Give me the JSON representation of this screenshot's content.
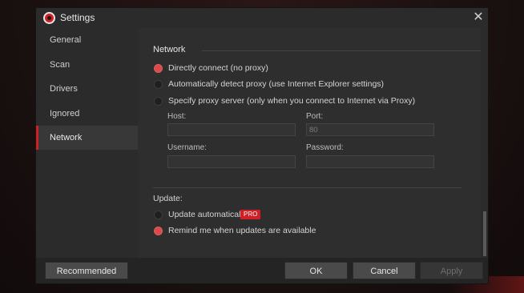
{
  "window": {
    "title": "Settings",
    "close_icon": "close-icon",
    "logo_icon": "app-logo-icon"
  },
  "sidebar": {
    "items": [
      {
        "label": "General",
        "active": false
      },
      {
        "label": "Scan",
        "active": false
      },
      {
        "label": "Drivers",
        "active": false
      },
      {
        "label": "Ignored",
        "active": false
      },
      {
        "label": "Network",
        "active": true
      }
    ]
  },
  "network": {
    "title": "Network",
    "options": [
      {
        "label": "Directly connect (no proxy)",
        "checked": true
      },
      {
        "label": "Automatically detect proxy (use Internet Explorer settings)",
        "checked": false
      },
      {
        "label": "Specify proxy server (only when you connect to Internet via Proxy)",
        "checked": false
      }
    ],
    "host": {
      "label": "Host:",
      "value": ""
    },
    "port": {
      "label": "Port:",
      "value": "80"
    },
    "username": {
      "label": "Username:",
      "value": ""
    },
    "password": {
      "label": "Password:",
      "value": ""
    }
  },
  "update": {
    "title": "Update:",
    "options": [
      {
        "label": "Update automatically",
        "checked": false,
        "badge": "PRO"
      },
      {
        "label": "Remind me when updates are available",
        "checked": true
      }
    ]
  },
  "footer": {
    "recommended_label": "Recommended",
    "ok_label": "OK",
    "cancel_label": "Cancel",
    "apply_label": "Apply"
  },
  "colors": {
    "accent": "#d11f26",
    "radio_checked": "#d94a4a",
    "window_bg": "#2b2b2b",
    "button_bg": "#4a4a4a"
  }
}
